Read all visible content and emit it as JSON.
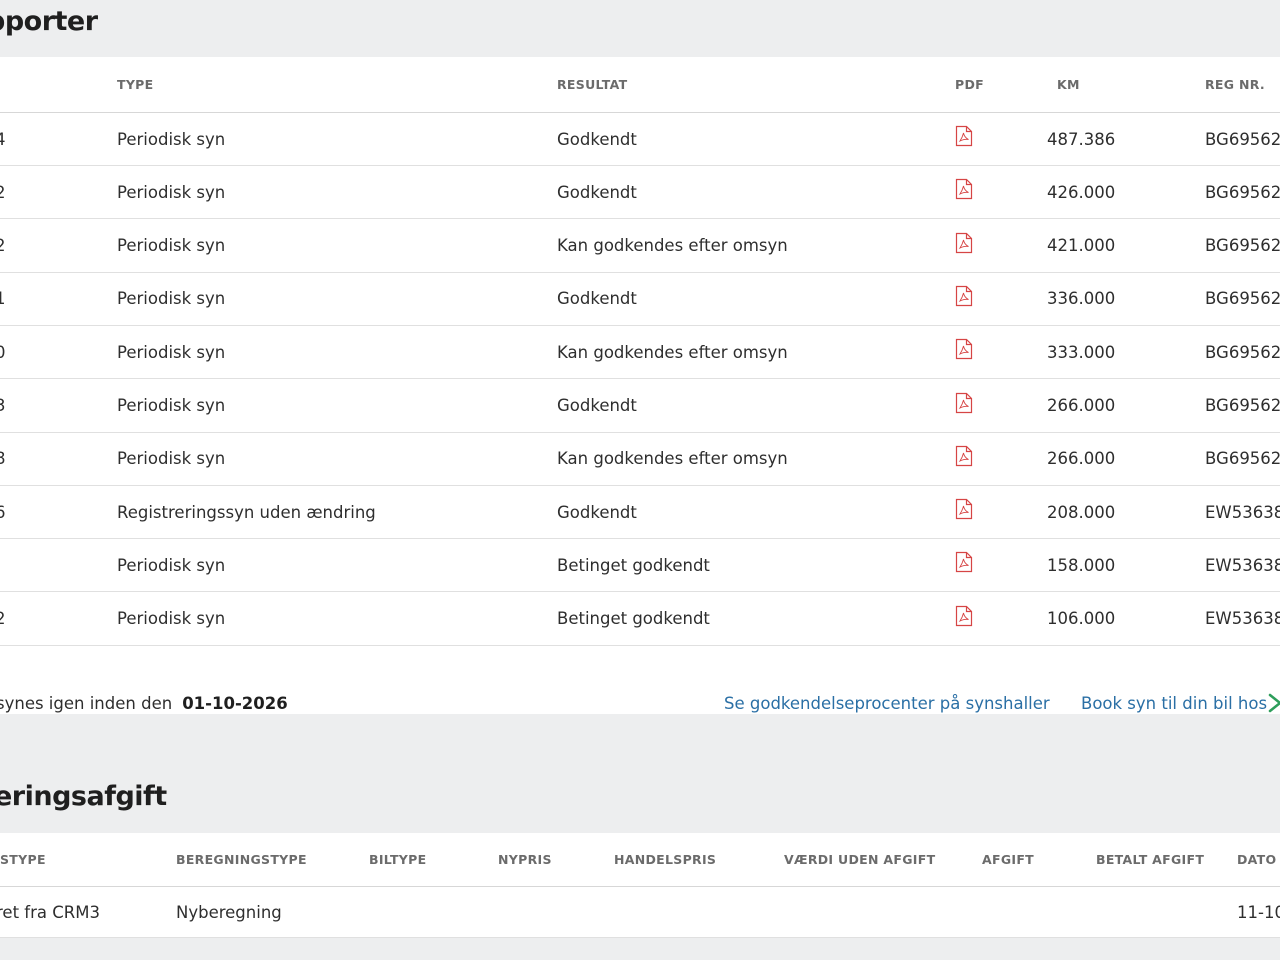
{
  "section1": {
    "title": "pporter",
    "columns": {
      "type": "TYPE",
      "result": "RESULTAT",
      "pdf": "PDF",
      "km": "KM",
      "reg": "REG NR."
    },
    "rows": [
      {
        "date": "4",
        "type": "Periodisk syn",
        "result": "Godkendt",
        "km": "487.386",
        "reg": "BG69562"
      },
      {
        "date": "2",
        "type": "Periodisk syn",
        "result": "Godkendt",
        "km": "426.000",
        "reg": "BG69562"
      },
      {
        "date": "2",
        "type": "Periodisk syn",
        "result": "Kan godkendes efter omsyn",
        "km": "421.000",
        "reg": "BG69562"
      },
      {
        "date": "1",
        "type": "Periodisk syn",
        "result": "Godkendt",
        "km": "336.000",
        "reg": "BG69562"
      },
      {
        "date": "0",
        "type": "Periodisk syn",
        "result": "Kan godkendes efter omsyn",
        "km": "333.000",
        "reg": "BG69562"
      },
      {
        "date": "3",
        "type": "Periodisk syn",
        "result": "Godkendt",
        "km": "266.000",
        "reg": "BG69562"
      },
      {
        "date": "8",
        "type": "Periodisk syn",
        "result": "Kan godkendes efter omsyn",
        "km": "266.000",
        "reg": "BG69562"
      },
      {
        "date": "6",
        "type": "Registreringssyn uden ændring",
        "result": "Godkendt",
        "km": "208.000",
        "reg": "EW53638"
      },
      {
        "date": "",
        "type": "Periodisk syn",
        "result": "Betinget godkendt",
        "km": "158.000",
        "reg": "EW53638"
      },
      {
        "date": "2",
        "type": "Periodisk syn",
        "result": "Betinget godkendt",
        "km": "106.000",
        "reg": "EW53638"
      }
    ],
    "footer": {
      "text": "synes igen inden den",
      "date": "01-10-2026",
      "link1": "Se godkendelseprocenter på synshaller",
      "link2": "Book syn til din bil hos"
    }
  },
  "section2": {
    "title": "eringsafgift",
    "columns": {
      "c1": "STYPE",
      "c2": "BEREGNINGSTYPE",
      "c3": "BILTYPE",
      "c4": "NYPRIS",
      "c5": "HANDELSPRIS",
      "c6": "VÆRDI UDEN AFGIFT",
      "c7": "AFGIFT",
      "c8": "BETALT AFGIFT",
      "c9": "DATO"
    },
    "row": {
      "c1": "ret fra CRM3",
      "c2": "Nyberegning",
      "c9": "11-10-"
    }
  },
  "icons": {
    "pdf": "pdf-file-icon",
    "arrow": "arrow-right-icon"
  },
  "colors": {
    "background": "#edeeef",
    "panel": "#ffffff",
    "link": "#2a6fa5",
    "pdf_icon": "#d64545",
    "arrow_icon": "#2e9e5b"
  }
}
